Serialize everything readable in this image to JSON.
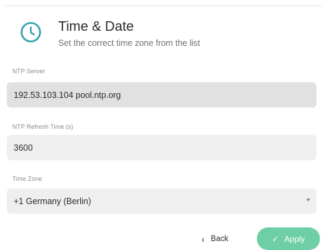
{
  "header": {
    "title": "Time & Date",
    "subtitle": "Set the correct time zone from the list"
  },
  "fields": {
    "ntp_server": {
      "label": "NTP Server",
      "value": "192.53.103.104 pool.ntp.org"
    },
    "ntp_refresh": {
      "label": "NTP Refresh Time (s)",
      "value": "3600"
    },
    "time_zone": {
      "label": "Time Zone",
      "value": "+1 Germany (Berlin)"
    }
  },
  "actions": {
    "back_label": "Back",
    "apply_label": "Apply"
  },
  "icons": {
    "header": "clock-icon",
    "back": "chevron-left-icon",
    "apply": "check-icon",
    "dropdown": "caret-down-icon"
  },
  "colors": {
    "accent": "#2fa3ad",
    "apply_button": "#6ecfa7"
  }
}
